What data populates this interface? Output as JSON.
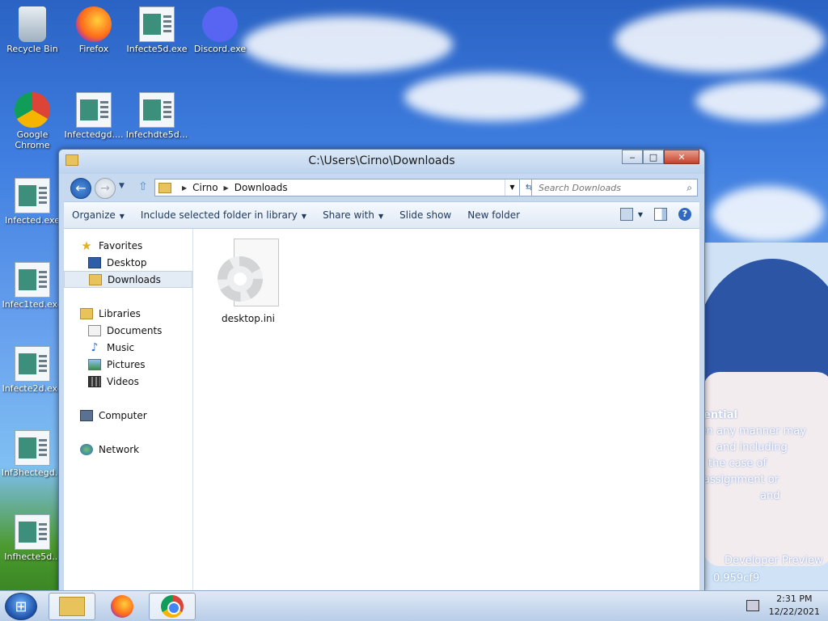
{
  "desktop": {
    "icons": [
      {
        "label": "Recycle Bin"
      },
      {
        "label": "Firefox"
      },
      {
        "label": "Infecte5d.exe"
      },
      {
        "label": "Discord.exe"
      },
      {
        "label": "Google Chrome"
      },
      {
        "label": "Infectedgd...."
      },
      {
        "label": "Infechdte5d..."
      },
      {
        "label": "Infected.exe"
      },
      {
        "label": "Infec1ted.exe"
      },
      {
        "label": "Infecte2d.exe"
      },
      {
        "label": "Inf3hectegd..."
      },
      {
        "label": "Infhecte5d..."
      }
    ],
    "wallpaper_text": [
      "ential",
      "in any manner may",
      "and including",
      "the case of",
      "assignment or",
      "and",
      "Developer Preview",
      "0.959cf9"
    ]
  },
  "window": {
    "title": "C:\\Users\\Cirno\\Downloads",
    "controls": {
      "minimize": "‒",
      "maximize": "□",
      "close": "✕"
    },
    "address": {
      "crumbs": [
        "Cirno",
        "Downloads"
      ]
    },
    "search": {
      "placeholder": "Search Downloads"
    },
    "toolbar": {
      "organize": "Organize",
      "include": "Include selected folder in library",
      "share": "Share with",
      "slideshow": "Slide show",
      "newfolder": "New folder"
    },
    "nav": {
      "favorites": "Favorites",
      "desktop": "Desktop",
      "downloads": "Downloads",
      "libraries": "Libraries",
      "documents": "Documents",
      "music": "Music",
      "pictures": "Pictures",
      "videos": "Videos",
      "computer": "Computer",
      "network": "Network"
    },
    "files": [
      {
        "name": "desktop.ini"
      }
    ]
  },
  "taskbar": {
    "time": "2:31 PM",
    "date": "12/22/2021"
  },
  "colors": {
    "accent": "#2f69c2",
    "selection": "#e3ebf5",
    "folder": "#e8c25a"
  }
}
